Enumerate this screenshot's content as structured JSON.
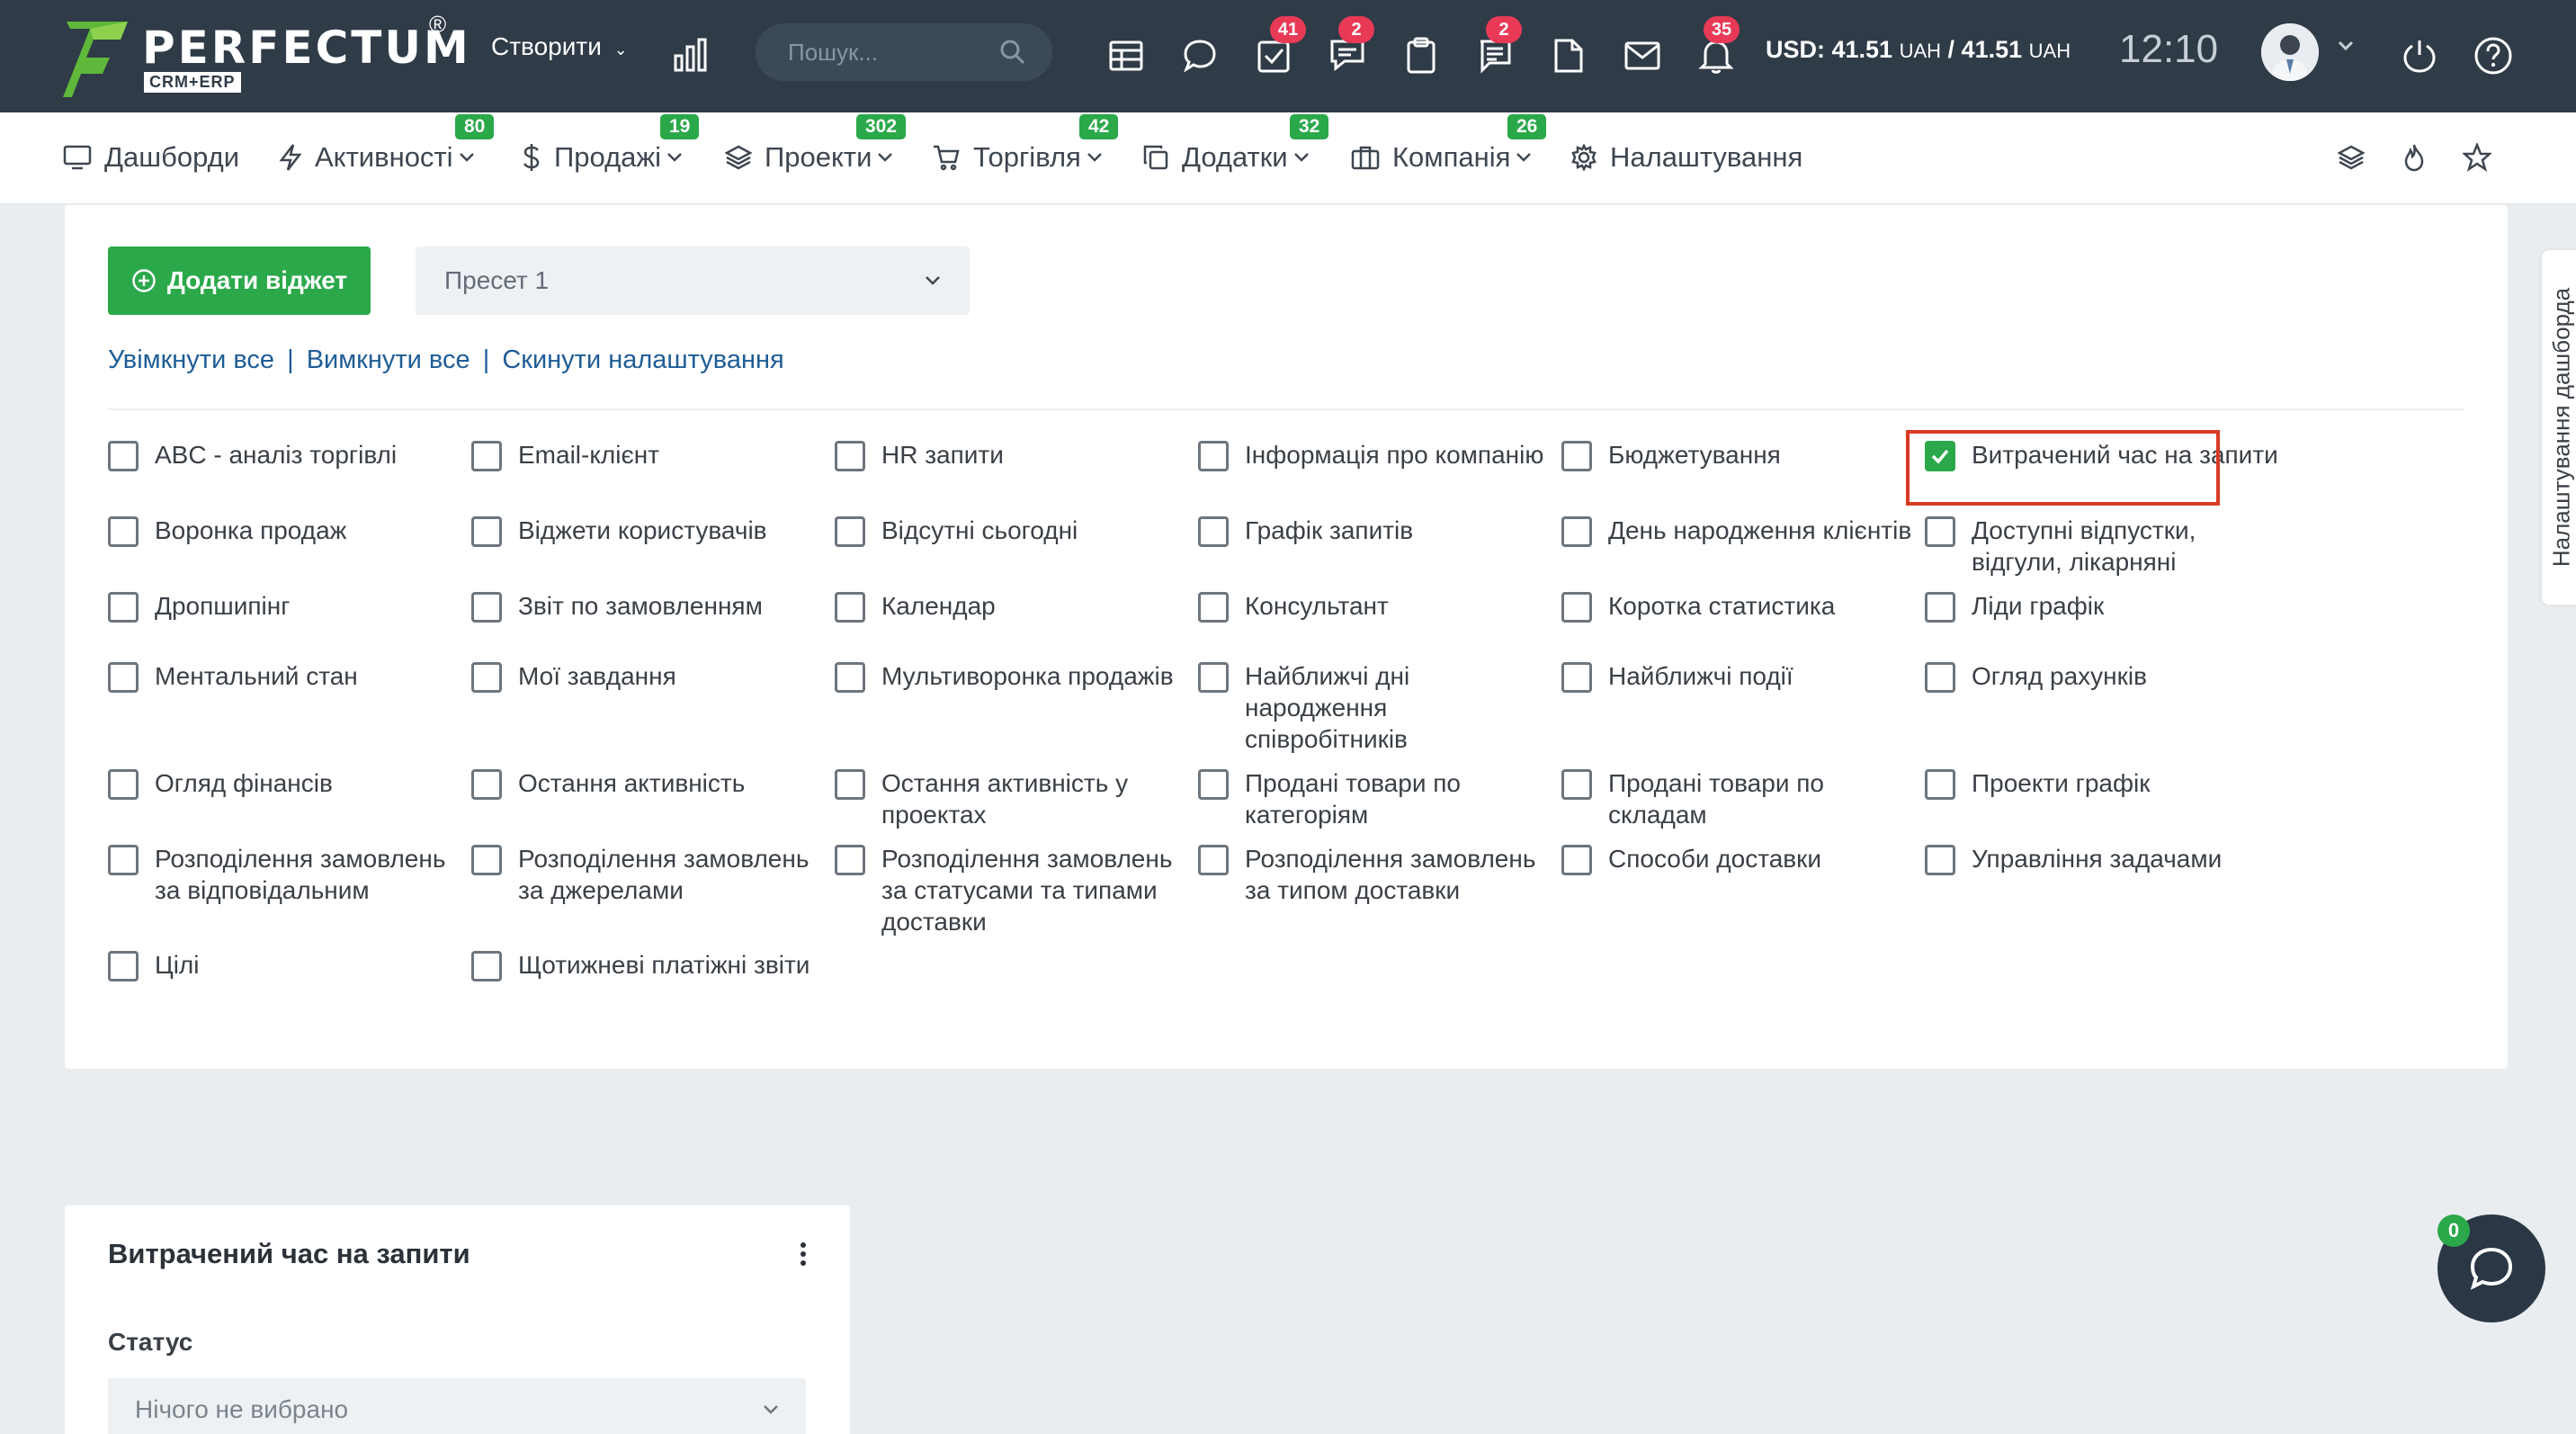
{
  "brand": {
    "name": "PERFECTUM",
    "sub": "CRM+ERP",
    "reg": "®"
  },
  "topbar": {
    "create_label": "Створити",
    "search_placeholder": "Пошук...",
    "icons": [
      {
        "name": "table-icon",
        "badge": ""
      },
      {
        "name": "chat-bubble-icon",
        "badge": ""
      },
      {
        "name": "task-check-icon",
        "badge": "41"
      },
      {
        "name": "comments-icon",
        "badge": "2"
      },
      {
        "name": "clipboard-icon",
        "badge": ""
      },
      {
        "name": "messages-icon",
        "badge": "2"
      },
      {
        "name": "document-icon",
        "badge": ""
      },
      {
        "name": "mail-icon",
        "badge": ""
      },
      {
        "name": "bell-icon",
        "badge": "35"
      }
    ],
    "currency_usd": "USD: 41.51",
    "currency_unit1": "UAH",
    "currency_sep": " / 41.51",
    "currency_unit2": "UAH",
    "time": "12:10"
  },
  "nav": {
    "items": [
      {
        "label": "Дашборди",
        "badge": ""
      },
      {
        "label": "Активності",
        "badge": "80"
      },
      {
        "label": "Продажі",
        "badge": "19"
      },
      {
        "label": "Проекти",
        "badge": "302"
      },
      {
        "label": "Торгівля",
        "badge": "42"
      },
      {
        "label": "Додатки",
        "badge": "32"
      },
      {
        "label": "Компанія",
        "badge": "26"
      },
      {
        "label": "Налаштування",
        "badge": ""
      }
    ]
  },
  "settings": {
    "add_widget": "Додати віджет",
    "preset": "Пресет 1",
    "enable_all": "Увімкнути все",
    "disable_all": "Вимкнути все",
    "reset": "Скинути налаштування",
    "sep": "|",
    "widgets": [
      {
        "label": "ABC - аналіз торгівлі",
        "checked": false
      },
      {
        "label": "Email-клієнт",
        "checked": false
      },
      {
        "label": "HR запити",
        "checked": false
      },
      {
        "label": "Інформація про компанію",
        "checked": false
      },
      {
        "label": "Бюджетування",
        "checked": false
      },
      {
        "label": "Витрачений час на запити",
        "checked": true
      },
      {
        "label": "Воронка продаж",
        "checked": false
      },
      {
        "label": "Віджети користувачів",
        "checked": false
      },
      {
        "label": "Відсутні сьогодні",
        "checked": false
      },
      {
        "label": "Графік запитів",
        "checked": false
      },
      {
        "label": "День народження клієнтів",
        "checked": false
      },
      {
        "label": "Доступні відпустки, відгули, лікарняні",
        "checked": false
      },
      {
        "label": "Дропшипінг",
        "checked": false
      },
      {
        "label": "Звіт по замовленням",
        "checked": false
      },
      {
        "label": "Календар",
        "checked": false
      },
      {
        "label": "Консультант",
        "checked": false
      },
      {
        "label": "Коротка статистика",
        "checked": false
      },
      {
        "label": "Ліди графік",
        "checked": false
      },
      {
        "label": "Ментальний стан",
        "checked": false
      },
      {
        "label": "Мої завдання",
        "checked": false
      },
      {
        "label": "Мультиворонка продажів",
        "checked": false
      },
      {
        "label": "Найближчі дні народження співробітників",
        "checked": false
      },
      {
        "label": "Найближчі події",
        "checked": false
      },
      {
        "label": "Огляд рахунків",
        "checked": false
      },
      {
        "label": "Огляд фінансів",
        "checked": false
      },
      {
        "label": "Остання активність",
        "checked": false
      },
      {
        "label": "Остання активність у проектах",
        "checked": false
      },
      {
        "label": "Продані товари по категоріям",
        "checked": false
      },
      {
        "label": "Продані товари по складам",
        "checked": false
      },
      {
        "label": "Проекти графік",
        "checked": false
      },
      {
        "label": "Розподілення замовлень за відповідальним",
        "checked": false
      },
      {
        "label": "Розподілення замовлень за джерелами",
        "checked": false
      },
      {
        "label": "Розподілення замовлень за статусами та типами доставки",
        "checked": false
      },
      {
        "label": "Розподілення замовлень за типом доставки",
        "checked": false
      },
      {
        "label": "Способи доставки",
        "checked": false
      },
      {
        "label": "Управління задачами",
        "checked": false
      },
      {
        "label": "Цілі",
        "checked": false
      },
      {
        "label": "Щотижневі платіжні звіти",
        "checked": false
      }
    ]
  },
  "side_tab": "Налаштування дашборда",
  "widget": {
    "title": "Витрачений час на запити",
    "status_label": "Статус",
    "status_placeholder": "Нічого не вибрано"
  },
  "chat": {
    "badge": "0"
  },
  "colors": {
    "topbar": "#2f3b47",
    "accent": "#2aa84a",
    "badge": "#e83a56",
    "link": "#1f5d96",
    "highlight": "#d83a26"
  }
}
